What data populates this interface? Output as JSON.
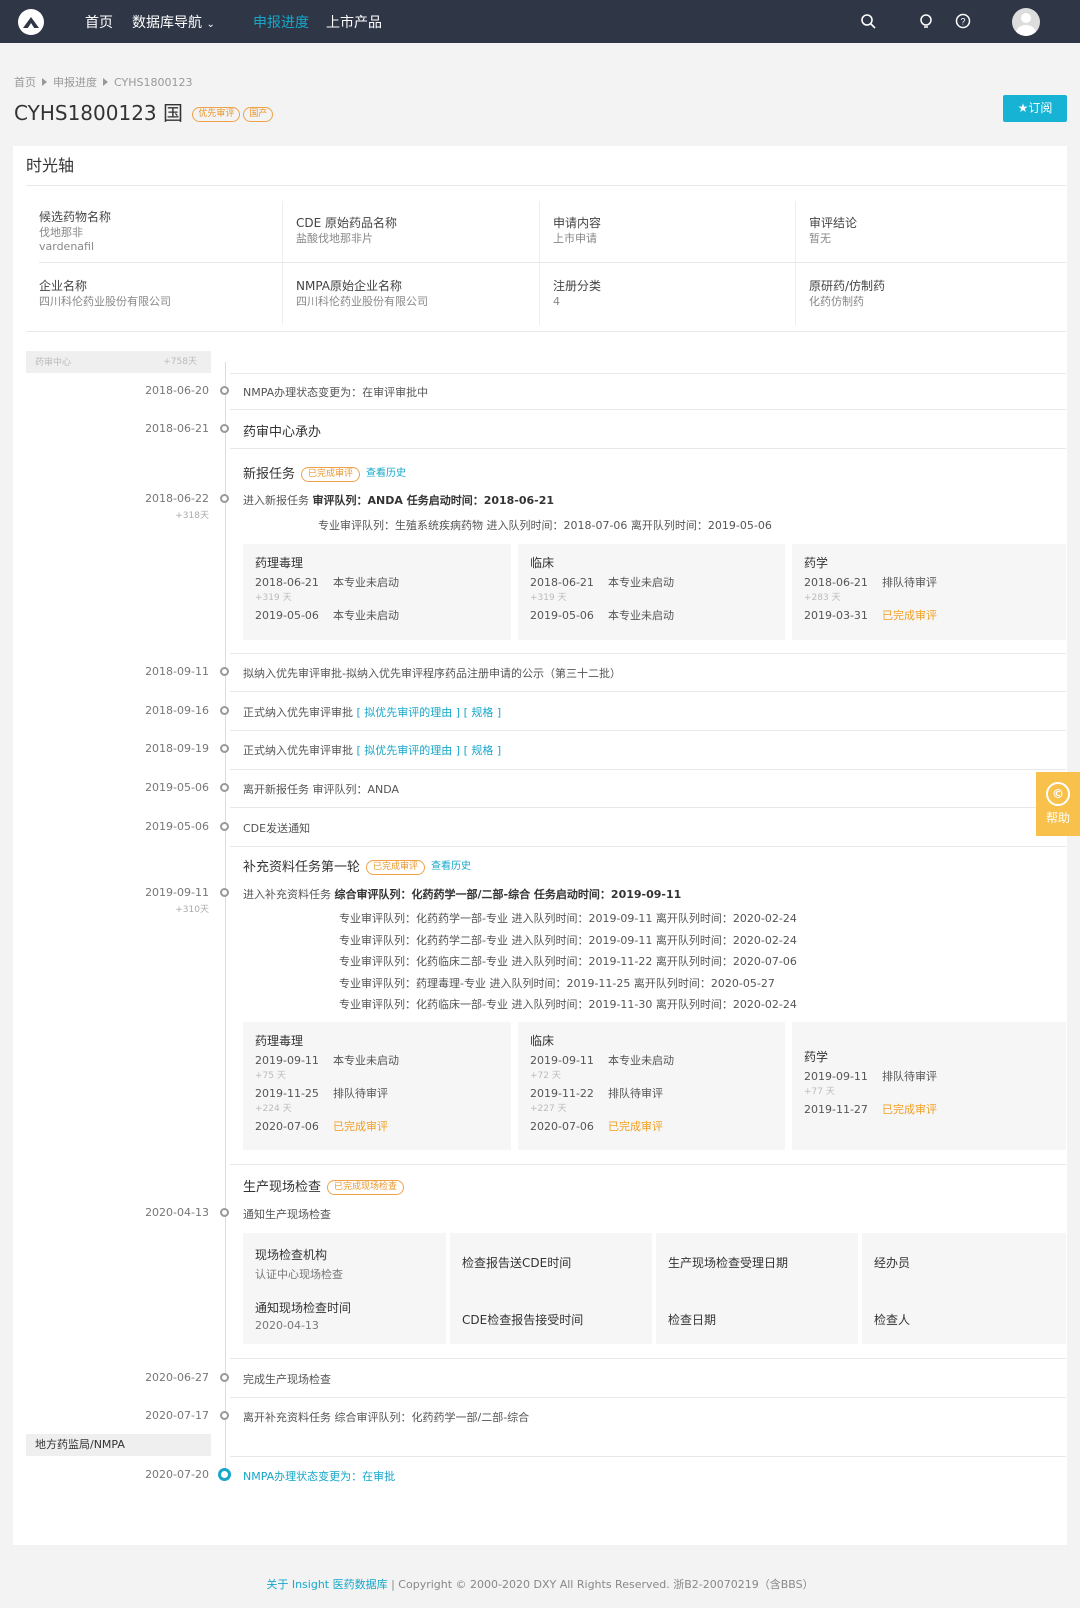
{
  "nav": {
    "home": "首页",
    "db": "数据库导航",
    "progress": "申报进度",
    "market": "上市产品"
  },
  "crumb": {
    "home": "首页",
    "progress": "申报进度",
    "current": "CYHS1800123"
  },
  "title": {
    "code": "CYHS1800123 国",
    "tag1": "优先审评",
    "tag2": "国产"
  },
  "subscribe": "★订阅",
  "section_title": "时光轴",
  "info": [
    {
      "label": "候选药物名称",
      "v1": "伐地那非",
      "v2": "vardenafil"
    },
    {
      "label": "CDE 原始药品名称",
      "v1": "盐酸伐地那非片"
    },
    {
      "label": "申请内容",
      "v1": "上市申请"
    },
    {
      "label": "审评结论",
      "v1": "暂无"
    },
    {
      "label": "企业名称",
      "v1": "四川科伦药业股份有限公司"
    },
    {
      "label": "NMPA原始企业名称",
      "v1": "四川科伦药业股份有限公司"
    },
    {
      "label": "注册分类",
      "v1": "4"
    },
    {
      "label": "原研药/仿制药",
      "v1": "化药仿制药"
    }
  ],
  "sec1": {
    "name": "药审中心",
    "days": "+758天"
  },
  "sec2": {
    "name": "地方药监局/NMPA"
  },
  "events": {
    "e1d": "2018-06-20",
    "e1": "NMPA办理状态变更为：在审评审批中",
    "e2d": "2018-06-21",
    "e2": "药审中心承办",
    "task1": "新报任务",
    "task1tag": "已完成审评",
    "task1hist": "查看历史",
    "e3d": "2018-06-22",
    "e3s": "+318天",
    "e3a": "进入新报任务",
    "e3b": "审评队列：ANDA   任务启动时间：2018-06-21",
    "e3c": "专业审评队列：生殖系统疾病药物   进入队列时间：2018-07-06   离开队列时间：2019-05-06",
    "e4d": "2018-09-11",
    "e4": "拟纳入优先审评审批-拟纳入优先审评程序药品注册申请的公示（第三十二批）",
    "e5d": "2018-09-16",
    "e5": "正式纳入优先审评审批",
    "e5l": "[ 拟优先审评的理由 ] [ 规格 ]",
    "e6d": "2018-09-19",
    "e6": "正式纳入优先审评审批",
    "e6l": "[ 拟优先审评的理由 ] [ 规格 ]",
    "e7d": "2019-05-06",
    "e7": "离开新报任务   审评队列：ANDA",
    "e8d": "2019-05-06",
    "e8": "CDE发送通知",
    "task2": "补充资料任务第一轮",
    "task2tag": "已完成审评",
    "task2hist": "查看历史",
    "e9d": "2019-09-11",
    "e9s": "+310天",
    "e9a": "进入补充资料任务",
    "e9b": "综合审评队列：化药药学一部/二部-综合   任务启动时间：2019-09-11",
    "q1": "专业审评队列：化药药学一部-专业   进入队列时间：2019-09-11   离开队列时间：2020-02-24",
    "q2": "专业审评队列：化药药学二部-专业   进入队列时间：2019-09-11   离开队列时间：2020-02-24",
    "q3": "专业审评队列：化药临床二部-专业   进入队列时间：2019-11-22   离开队列时间：2020-07-06",
    "q4": "专业审评队列：药理毒理-专业   进入队列时间：2019-11-25   离开队列时间：2020-05-27",
    "q5": "专业审评队列：化药临床一部-专业   进入队列时间：2019-11-30   离开队列时间：2020-02-24",
    "task3": "生产现场检查",
    "task3tag": "已完成现场检查",
    "e10d": "2020-04-13",
    "e10": "通知生产现场检查",
    "e11d": "2020-06-27",
    "e11": "完成生产现场检查",
    "e12d": "2020-07-17",
    "e12": "离开补充资料任务   综合审评队列：化药药学一部/二部-综合",
    "e13d": "2020-07-20",
    "e13": "NMPA办理状态变更为：在审批"
  },
  "b1": {
    "c1": {
      "t": "药理毒理",
      "r1d": "2018-06-21",
      "r1s": "本专业未启动",
      "g": "+319 天",
      "r2d": "2019-05-06",
      "r2s": "本专业未启动"
    },
    "c2": {
      "t": "临床",
      "r1d": "2018-06-21",
      "r1s": "本专业未启动",
      "g": "+319 天",
      "r2d": "2019-05-06",
      "r2s": "本专业未启动"
    },
    "c3": {
      "t": "药学",
      "r1d": "2018-06-21",
      "r1s": "排队待审评",
      "g": "+283 天",
      "r2d": "2019-03-31",
      "r2s": "已完成审评"
    }
  },
  "b2": {
    "c1": {
      "t": "药理毒理",
      "r1d": "2019-09-11",
      "r1s": "本专业未启动",
      "g1": "+75 天",
      "r2d": "2019-11-25",
      "r2s": "排队待审评",
      "g2": "+224 天",
      "r3d": "2020-07-06",
      "r3s": "已完成审评"
    },
    "c2": {
      "t": "临床",
      "r1d": "2019-09-11",
      "r1s": "本专业未启动",
      "g1": "+72 天",
      "r2d": "2019-11-22",
      "r2s": "排队待审评",
      "g2": "+227 天",
      "r3d": "2020-07-06",
      "r3s": "已完成审评"
    },
    "c3": {
      "t": "药学",
      "r1d": "2019-09-11",
      "r1s": "排队待审评",
      "g1": "+77 天",
      "r2d": "2019-11-27",
      "r2s": "已完成审评"
    }
  },
  "insp": {
    "org_l": "现场检查机构",
    "org_v": "认证中心现场检查",
    "cde_send": "检查报告送CDE时间",
    "accept": "生产现场检查受理日期",
    "handler": "经办员",
    "notify_l": "通知现场检查时间",
    "notify_v": "2020-04-13",
    "cde_recv": "CDE检查报告接受时间",
    "date": "检查日期",
    "inspector": "检查人"
  },
  "help": {
    "icon": "©",
    "label": "帮助"
  },
  "footer": {
    "link": "关于 Insight 医药数据库",
    "text": "|  Copyright © 2000-2020 DXY All Rights Reserved. 浙B2-20070219（含BBS）"
  }
}
